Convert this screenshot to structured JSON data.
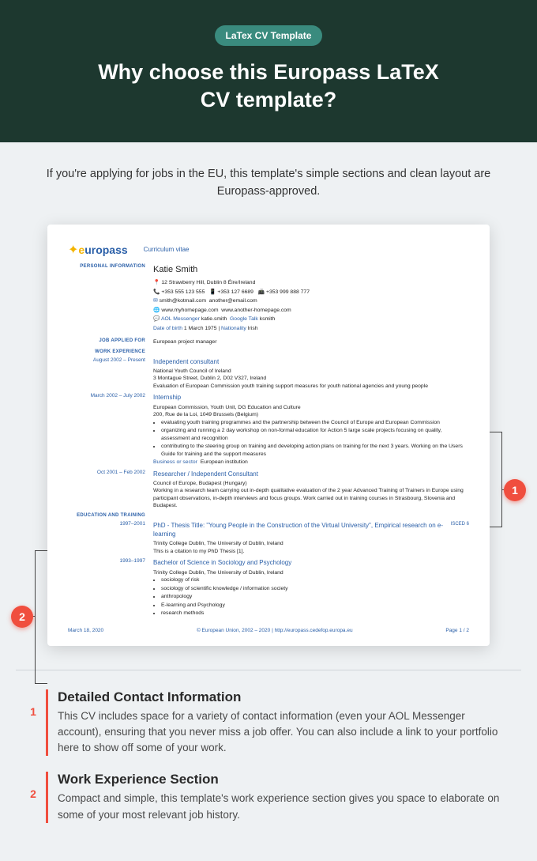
{
  "header": {
    "badge": "LaTex CV Template",
    "title_line1": "Why choose this Europass LaTeX",
    "title_line2": "CV template?"
  },
  "intro": "If you're applying for jobs in the EU, this template's simple sections and clean layout are Europass-approved.",
  "cv": {
    "logo_prefix": "e",
    "logo_rest": "uropass",
    "doc_label": "Curriculum vitae",
    "sections": {
      "personal_info": "PERSONAL INFORMATION",
      "job_applied": "JOB APPLIED FOR",
      "work_exp": "WORK EXPERIENCE",
      "edu_training": "EDUCATION AND TRAINING"
    },
    "name": "Katie Smith",
    "address": "12 Strawberry Hill, Dublin 8 Éire/Ireland",
    "phone1": "+353 555 123 555",
    "phone2": "+353 127 6689",
    "phone3": "+353 999 888 777",
    "email1": "smith@kotmail.com",
    "email2": "another@email.com",
    "web1": "www.myhomepage.com",
    "web2": "www.another-homepage.com",
    "im_label1": "AOL Messenger",
    "im1": "katie.smith",
    "im_label2": "Google Talk",
    "im2": "ksmith",
    "dob_label": "Date of birth",
    "dob": "1 March 1975",
    "nat_label": "Nationality",
    "nat": "Irish",
    "job_title": "European project manager",
    "exp1": {
      "dates": "August 2002 – Present",
      "title": "Independent consultant",
      "org": "National Youth Council of Ireland",
      "addr": "3 Montague Street, Dublin 2, D02 V327, Ireland",
      "desc": "Evaluation of European Commission youth training support measures for youth national agencies and young people"
    },
    "exp2": {
      "dates": "March 2002 – July 2002",
      "title": "Internship",
      "org": "European Commission, Youth Unit, DG Education and Culture",
      "addr": "200, Rue de la Loi, 1049 Brussels (Belgium)",
      "b1": "evaluating youth training programmes and the partnership between the Council of Europe and European Commission",
      "b2": "organizing and running a 2 day workshop on non-formal education for Action 5 large scale projects focusing on quality, assessment and recognition",
      "b3": "contributing to the steering group on training and developing action plans on training for the next 3 years. Working on the Users Guide for training and the support measures",
      "sector_label": "Business or sector",
      "sector": "European institution"
    },
    "exp3": {
      "dates": "Oct 2001 – Feb 2002",
      "title": "Researcher / Independent Consultant",
      "org": "Council of Europe, Budapest (Hungary)",
      "desc": "Working in a research team carrying out in-depth qualitative evaluation of the 2 year Advanced Training of Trainers in Europe using participant observations, in-depth interviews and focus groups. Work carried out in training courses in Strasbourg, Slovenia and Budapest."
    },
    "edu1": {
      "dates": "1997–2001",
      "title": "PhD - Thesis Title: \"Young People in the Construction of the Virtual University\", Empirical research on e-learning",
      "isced": "ISCED 6",
      "org": "Trinity College Dublin, The University of Dublin, Ireland",
      "note": "This is a citation to my PhD Thesis [1]."
    },
    "edu2": {
      "dates": "1993–1997",
      "title": "Bachelor of Science in Sociology and Psychology",
      "org": "Trinity College Dublin, The University of Dublin, Ireland",
      "b1": "sociology of risk",
      "b2": "sociology of scientific knowledge / information society",
      "b3": "anthropology",
      "b4": "E-learning and Psychology",
      "b5": "research methods"
    },
    "footer_date": "March 18, 2020",
    "footer_copy": "© European Union, 2002 – 2020 | http://europass.cedefop.europa.eu",
    "footer_page": "Page 1 / 2"
  },
  "callouts": {
    "one": "1",
    "two": "2"
  },
  "features": [
    {
      "num": "1",
      "title": "Detailed Contact Information",
      "text": "This CV includes space for a variety of contact information (even your AOL Messenger account), ensuring that you never miss a job offer. You can also include a link to your portfolio here to show off some of your work."
    },
    {
      "num": "2",
      "title": "Work Experience Section",
      "text": "Compact and simple, this template's work experience section gives you space to elaborate on some of your most relevant job history."
    }
  ]
}
